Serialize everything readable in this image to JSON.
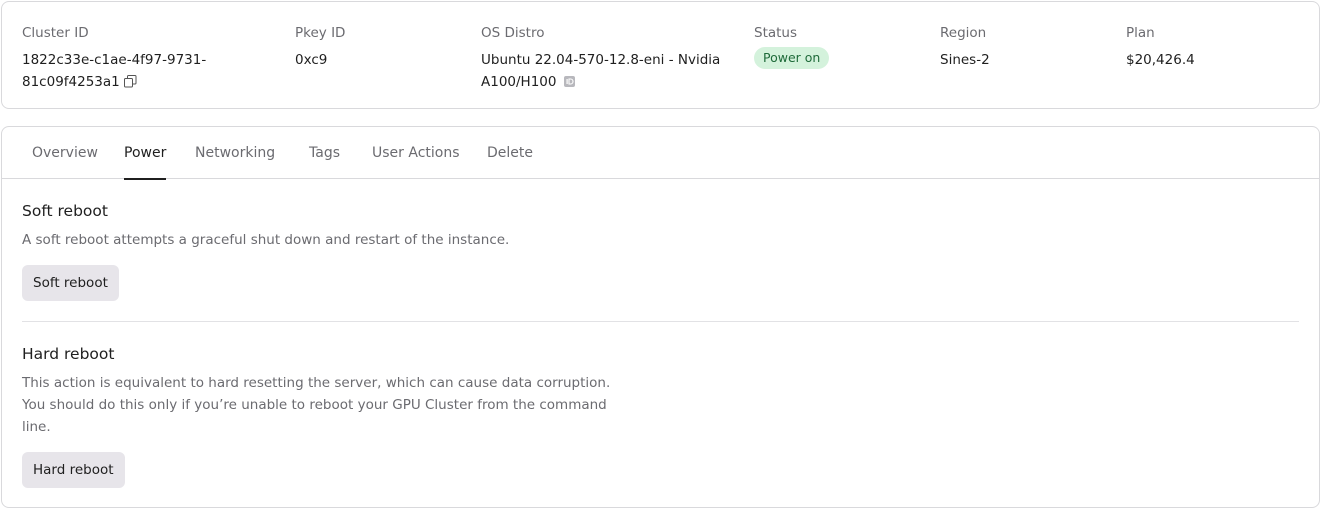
{
  "summary": {
    "cluster_id": {
      "label": "Cluster ID",
      "value_line1": "1822c33e-c1ae-4f97-9731-",
      "value_line2": "81c09f4253a1"
    },
    "pkey_id": {
      "label": "Pkey ID",
      "value": "0xc9"
    },
    "os_distro": {
      "label": "OS Distro",
      "value_line1": "Ubuntu 22.04-570-12.8-eni - Nvidia",
      "value_line2": "A100/H100"
    },
    "status": {
      "label": "Status",
      "value": "Power on",
      "color": "#d4f2dc"
    },
    "region": {
      "label": "Region",
      "value": "Sines-2"
    },
    "plan": {
      "label": "Plan",
      "value": "$20,426.4"
    }
  },
  "tabs": [
    {
      "label": "Overview"
    },
    {
      "label": "Power",
      "active": true
    },
    {
      "label": "Networking"
    },
    {
      "label": "Tags"
    },
    {
      "label": "User Actions"
    },
    {
      "label": "Delete"
    }
  ],
  "power": {
    "soft": {
      "title": "Soft reboot",
      "description": "A soft reboot attempts a graceful shut down and restart of the instance.",
      "button_label": "Soft reboot"
    },
    "hard": {
      "title": "Hard reboot",
      "description_line1": "This action is equivalent to hard resetting the server, which can cause data corruption.",
      "description_line2": "You should do this only if you’re unable to reboot your GPU Cluster from the command",
      "description_line3": "line.",
      "button_label": "Hard reboot"
    }
  },
  "icons": {
    "copy": "copy-icon",
    "id": "id-badge-icon"
  }
}
